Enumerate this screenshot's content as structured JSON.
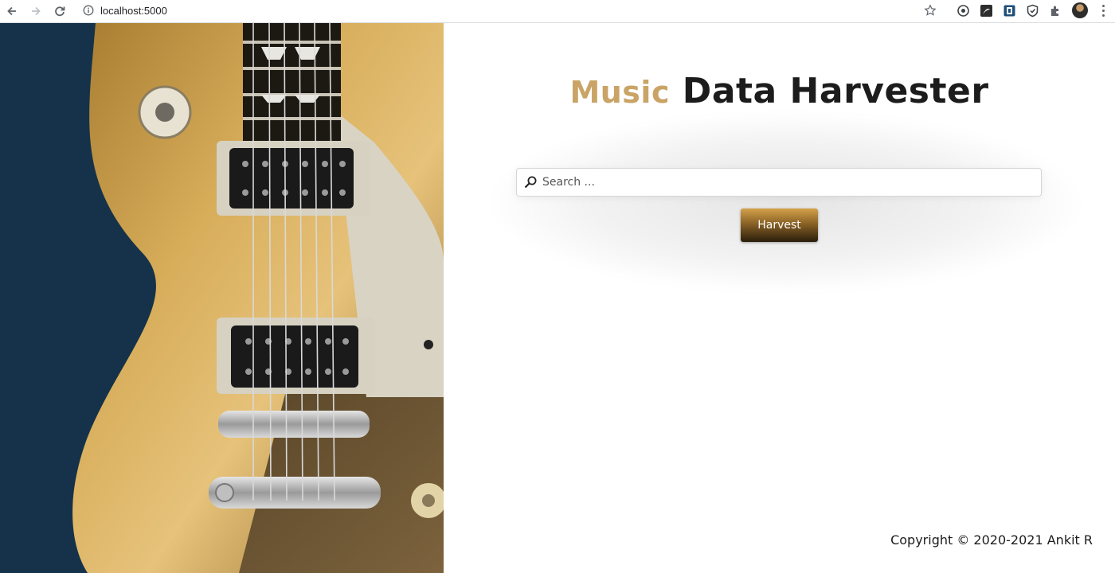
{
  "browser": {
    "url": "localhost:5000",
    "icons": {
      "back": "arrow-left-icon",
      "forward": "arrow-right-icon",
      "reload": "reload-icon",
      "site_info": "info-icon",
      "bookmark": "star-icon",
      "extensions": [
        "extension-1-icon",
        "pdf-extension-icon",
        "extension-3-icon",
        "shield-extension-icon",
        "puzzle-icon"
      ],
      "profile": "avatar",
      "menu": "kebab-menu-icon"
    }
  },
  "page": {
    "title_accent": "Music",
    "title_rest": " Data Harvester",
    "search_placeholder": "Search ...",
    "search_value": "",
    "harvest_label": "Harvest",
    "copyright": "Copyright © 2020-2021 Ankit R"
  },
  "colors": {
    "accent_gold": "#c9a466",
    "title_dark": "#1c1c1c",
    "button_top": "#d4a14a",
    "button_bottom": "#2a1d0c"
  }
}
